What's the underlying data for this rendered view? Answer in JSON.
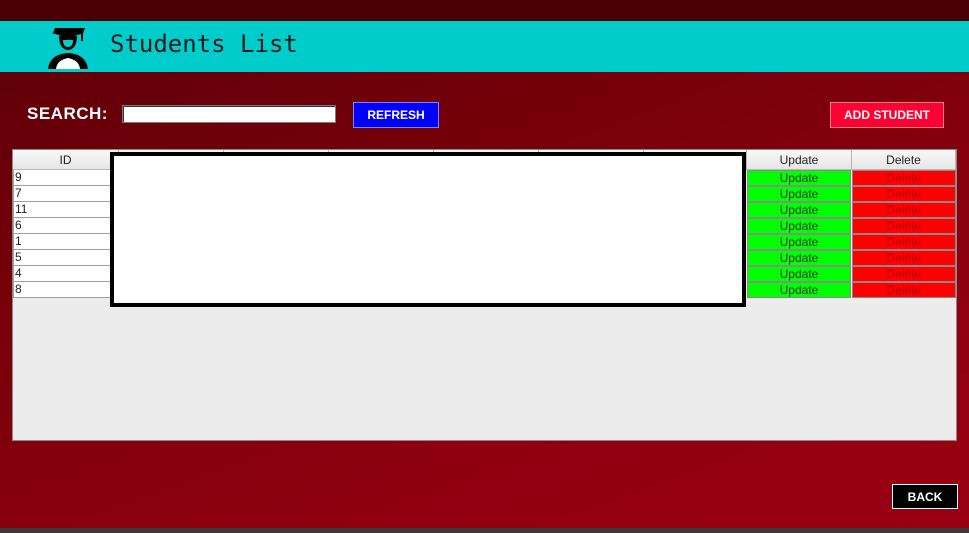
{
  "header": {
    "title": "Students List",
    "logo_icon": "student-graduate-icon"
  },
  "search": {
    "label": "SEARCH:",
    "value": "",
    "placeholder": ""
  },
  "buttons": {
    "refresh": "REFRESH",
    "add_student": "ADD STUDENT",
    "back": "BACK"
  },
  "table": {
    "columns": [
      "ID",
      "",
      "",
      "",
      "",
      "",
      "",
      "Update",
      "Delete"
    ],
    "rows": [
      {
        "id": "9",
        "update": "Update",
        "delete": "Delete"
      },
      {
        "id": "7",
        "update": "Update",
        "delete": "Delete"
      },
      {
        "id": "11",
        "update": "Update",
        "delete": "Delete"
      },
      {
        "id": "6",
        "update": "Update",
        "delete": "Delete"
      },
      {
        "id": "1",
        "update": "Update",
        "delete": "Delete"
      },
      {
        "id": "5",
        "update": "Update",
        "delete": "Delete"
      },
      {
        "id": "4",
        "update": "Update",
        "delete": "Delete"
      },
      {
        "id": "8",
        "update": "Update",
        "delete": "Delete"
      }
    ]
  },
  "colors": {
    "header_bg": "#00cccc",
    "refresh_bg": "#0000ff",
    "add_bg": "#ff0033",
    "update_bg": "#00ff00",
    "delete_bg": "#ff0000",
    "back_bg": "#000000"
  }
}
